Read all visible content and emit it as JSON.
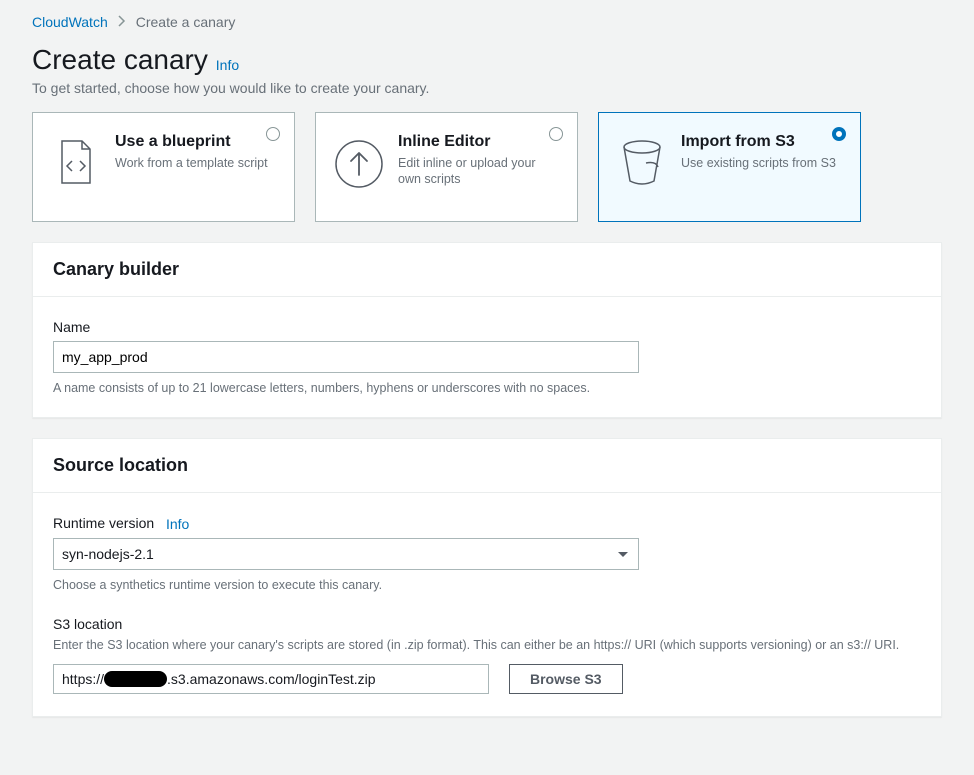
{
  "breadcrumb": {
    "root": "CloudWatch",
    "current": "Create a canary"
  },
  "header": {
    "title": "Create canary",
    "info": "Info",
    "subtitle": "To get started, choose how you would like to create your canary."
  },
  "options": {
    "blueprint": {
      "title": "Use a blueprint",
      "desc": "Work from a template script"
    },
    "inline": {
      "title": "Inline Editor",
      "desc": "Edit inline or upload your own scripts"
    },
    "s3": {
      "title": "Import from S3",
      "desc": "Use existing scripts from S3"
    },
    "selected": "s3"
  },
  "builder": {
    "panel_title": "Canary builder",
    "name_label": "Name",
    "name_value": "my_app_prod",
    "name_helper": "A name consists of up to 21 lowercase letters, numbers, hyphens or underscores with no spaces."
  },
  "source": {
    "panel_title": "Source location",
    "runtime_label": "Runtime version",
    "runtime_info": "Info",
    "runtime_value": "syn-nodejs-2.1",
    "runtime_helper": "Choose a synthetics runtime version to execute this canary.",
    "s3_label": "S3 location",
    "s3_desc": "Enter the S3 location where your canary's scripts are stored (in .zip format). This can either be an https:// URI (which supports versioning) or an s3:// URI.",
    "s3_prefix": "https://",
    "s3_suffix": ".s3.amazonaws.com/loginTest.zip",
    "browse": "Browse S3"
  }
}
